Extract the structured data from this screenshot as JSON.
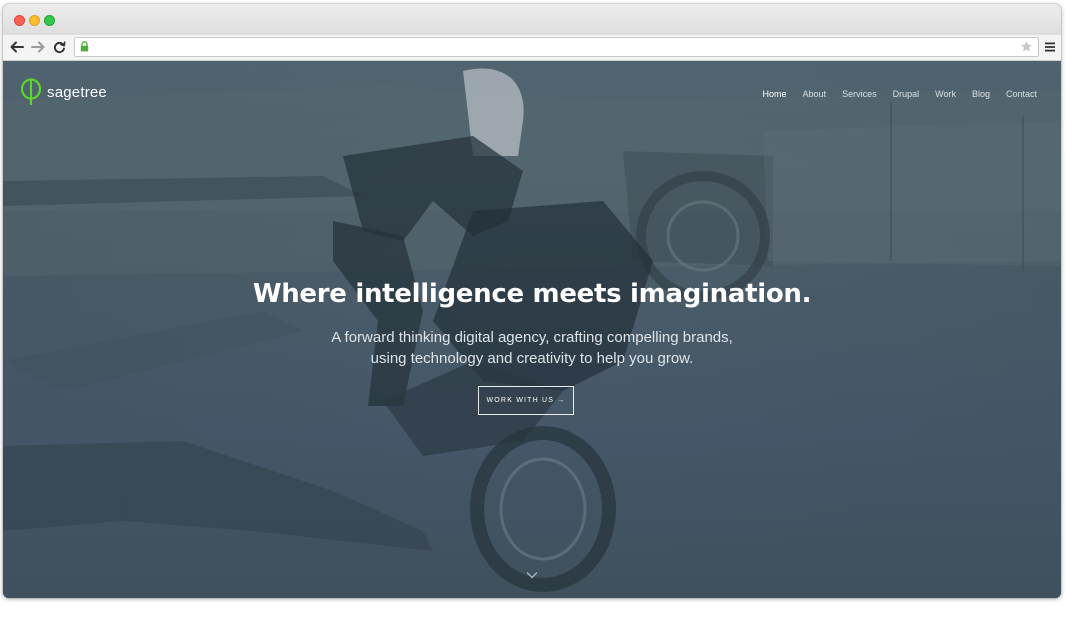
{
  "browser": {
    "traffic_lights": [
      "close",
      "minimize",
      "zoom"
    ],
    "url": ""
  },
  "site": {
    "logo_text": "sagetree",
    "brand_color": "#5bd62e",
    "nav": [
      {
        "label": "Home",
        "active": true
      },
      {
        "label": "About",
        "active": false
      },
      {
        "label": "Services",
        "active": false
      },
      {
        "label": "Drupal",
        "active": false
      },
      {
        "label": "Work",
        "active": false
      },
      {
        "label": "Blog",
        "active": false
      },
      {
        "label": "Contact",
        "active": false
      }
    ]
  },
  "hero": {
    "headline": "Where intelligence meets imagination.",
    "subline_1": "A forward thinking digital agency, crafting compelling brands,",
    "subline_2": "using technology and creativity to help you grow.",
    "cta_label": "WORK WITH US →",
    "overlay_color": "#465866"
  },
  "icons": [
    "back-arrow-icon",
    "forward-arrow-icon",
    "reload-icon",
    "lock-icon",
    "star-icon",
    "menu-icon",
    "sagetree-logo-icon",
    "chevron-down-icon"
  ]
}
